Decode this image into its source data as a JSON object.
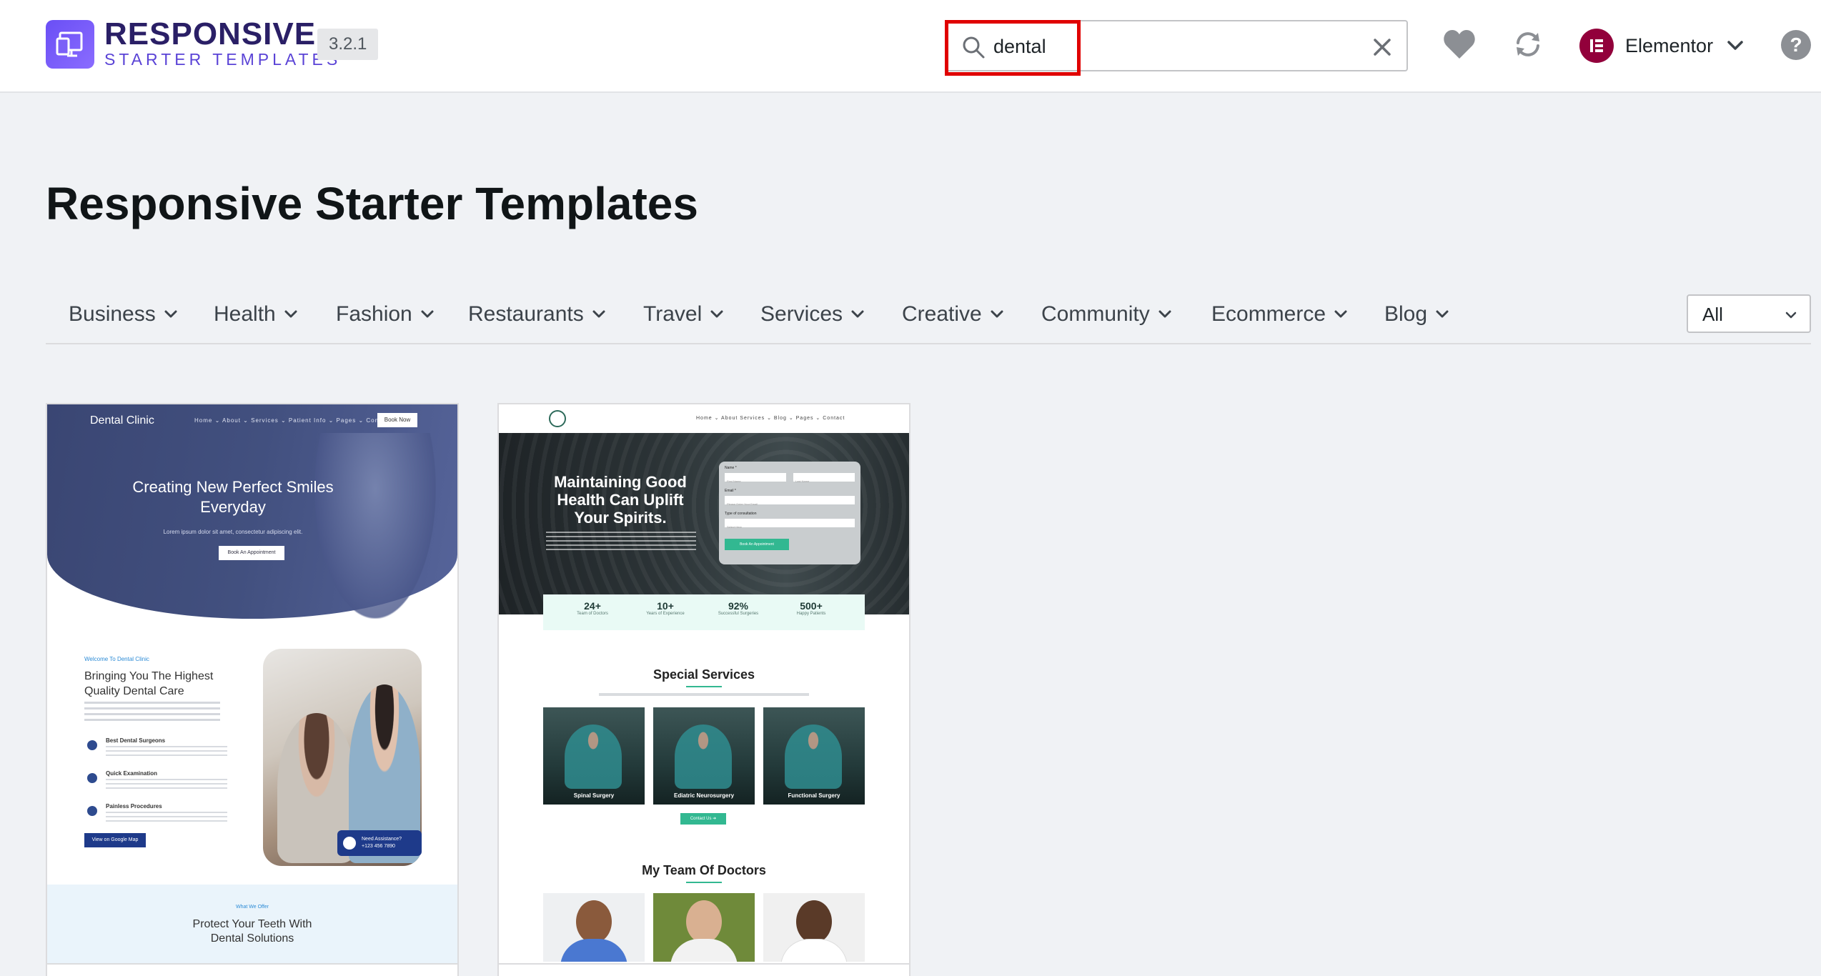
{
  "header": {
    "brand_main": "RESPONSIVE",
    "brand_sub": "STARTER TEMPLATES",
    "version": "3.2.1",
    "search": {
      "value": "dental",
      "placeholder": ""
    },
    "builder": "Elementor",
    "help": "?",
    "icons": [
      "search-icon",
      "clear-icon",
      "heart-icon",
      "sync-icon",
      "elementor-logo-icon",
      "chevron-down-icon",
      "help-icon"
    ]
  },
  "page_title": "Responsive Starter Templates",
  "categories": [
    "Business",
    "Health",
    "Fashion",
    "Restaurants",
    "Travel",
    "Services",
    "Creative",
    "Community",
    "Ecommerce",
    "Blog"
  ],
  "filter": {
    "selected": "All"
  },
  "templates": [
    {
      "logo": "Dental Clinic",
      "nav": "Home ⌄   About ⌄   Services ⌄   Patient Info ⌄   Pages ⌄   Contact",
      "book": "Book Now",
      "hero_title": "Creating New Perfect Smiles Everyday",
      "hero_sub": "Lorem ipsum dolor sit amet, consectetur adipiscing elit.",
      "hero_btn": "Book An Appointment",
      "welcome": "Welcome To Dental Clinic",
      "heading": "Bringing You The Highest Quality Dental Care",
      "features": [
        "Best Dental Surgeons",
        "Quick Examination",
        "Painless Procedures"
      ],
      "map_btn": "View on Google Map",
      "assist_title": "Need Assistance?",
      "assist_phone": "+123 456 7890",
      "offer_label": "What We Offer",
      "offer_heading": "Protect Your Teeth With Dental Solutions"
    },
    {
      "nav": "Home ⌄   About   Services ⌄   Blog ⌄   Pages ⌄   Contact",
      "hero_title": "Maintaining Good Health Can Uplift Your Spirits.",
      "form": {
        "name_label": "Name *",
        "first": "First Name",
        "last": "Last Name",
        "email_label": "Email *",
        "email_ph": "Please Enter Your Email",
        "type_label": "Type of consultation",
        "select_ph": "Select Here",
        "button": "Book An Appointment"
      },
      "stats": [
        {
          "num": "24+",
          "label": "Team of Doctors"
        },
        {
          "num": "10+",
          "label": "Years of Experience"
        },
        {
          "num": "92%",
          "label": "Successful Surgeries"
        },
        {
          "num": "500+",
          "label": "Happy Patients"
        }
      ],
      "special_title": "Special Services",
      "services": [
        "Spinal Surgery",
        "Ediatric Neurosurgery",
        "Functional Surgery"
      ],
      "contact_btn": "Contact Us ➔",
      "team_title": "My Team Of Doctors"
    }
  ]
}
